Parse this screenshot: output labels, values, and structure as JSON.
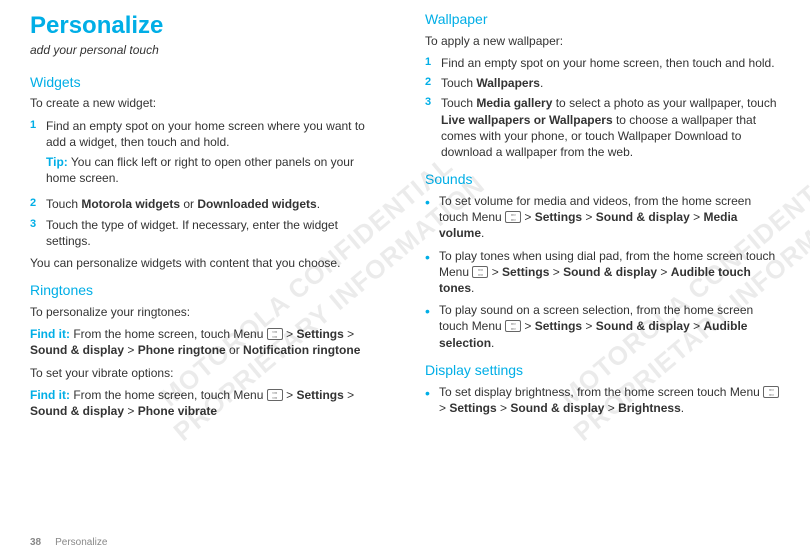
{
  "page": {
    "number": "38",
    "section": "Personalize"
  },
  "watermark": "MOTOROLA CONFIDENTIAL\nPROPRIETARY INFORMATION",
  "left": {
    "title": "Personalize",
    "subtitle": "add your personal touch",
    "widgets": {
      "heading": "Widgets",
      "intro": "To create a new widget:",
      "steps": [
        "Find an empty spot on your home screen where you want to add a widget, then touch and hold.",
        "",
        ""
      ],
      "tip_label": "Tip:",
      "tip_text": " You can flick left or right to open other panels on your home screen.",
      "step2_a": "Touch ",
      "step2_b1": "Motorola widgets",
      "step2_mid": " or ",
      "step2_b2": "Downloaded widgets",
      "step2_end": ".",
      "step3": "Touch the type of widget. If necessary, enter the widget settings.",
      "outro": "You can personalize widgets with content that you choose."
    },
    "ringtones": {
      "heading": "Ringtones",
      "intro": "To personalize your ringtones:",
      "findit": "Find it:",
      "p1_a": " From the home screen, touch Menu ",
      "p1_b": " > ",
      "p1_s1": "Settings",
      "p1_s2": "Sound & display",
      "p1_s3": "Phone ringtone",
      "p1_or": " or ",
      "p1_s4": "Notification ringtone",
      "vib_intro": "To set your vibrate options:",
      "p2_a": " From the home screen, touch Menu ",
      "p2_b": " > ",
      "p2_s1": "Settings",
      "p2_s2": "Sound & display",
      "p2_s3": "Phone vibrate"
    }
  },
  "right": {
    "wallpaper": {
      "heading": "Wallpaper",
      "intro": "To apply a new wallpaper:",
      "step1": "Find an empty spot on your home screen, then touch and hold.",
      "step2_a": "Touch ",
      "step2_b": "Wallpapers",
      "step2_end": ".",
      "step3_a": "Touch ",
      "step3_b1": "Media gallery",
      "step3_mid1": " to select a photo as your wallpaper, touch ",
      "step3_b2": "Live wallpapers or Wallpapers",
      "step3_mid2": " to choose a wallpaper that comes with your phone, or touch Wallpaper Download to download a wallpaper from the web."
    },
    "sounds": {
      "heading": "Sounds",
      "b1_a": "To set volume for media and videos, from the home screen touch Menu ",
      "b1_b": " > ",
      "b1_s1": "Settings",
      "b1_s2": "Sound & display",
      "b1_s3": "Media volume",
      "b1_end": ".",
      "b2_a": "To play tones when using dial pad, from the home screen touch Menu ",
      "b2_s3": "Audible touch tones",
      "b3_a": "To play sound on a screen selection, from the home screen touch Menu ",
      "b3_s3": "Audible selection"
    },
    "display": {
      "heading": "Display settings",
      "b1_a": "To set display brightness, from the home screen touch Menu ",
      "b1_b": " > ",
      "b1_s1": "Settings",
      "b1_s2": "Sound & display",
      "b1_s3": "Brightness",
      "b1_end": "."
    }
  }
}
